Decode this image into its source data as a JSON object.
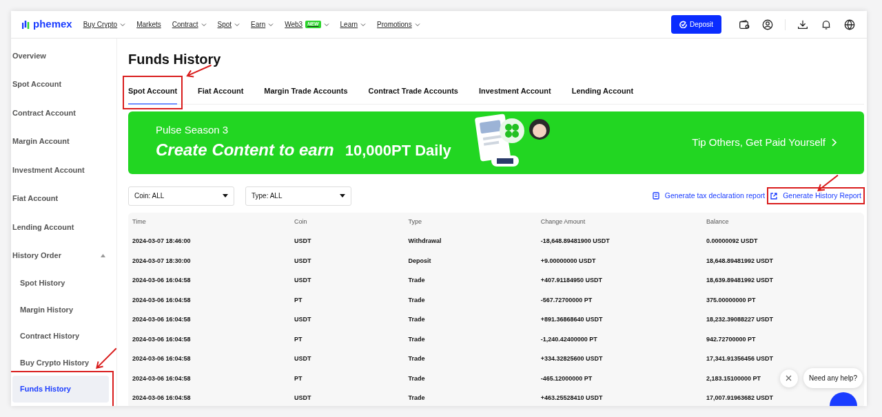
{
  "nav": {
    "logo": "phemex",
    "menu": [
      {
        "label": "Buy Crypto",
        "dropdown": true
      },
      {
        "label": "Markets",
        "dropdown": false
      },
      {
        "label": "Contract",
        "dropdown": true
      },
      {
        "label": "Spot",
        "dropdown": true
      },
      {
        "label": "Earn",
        "dropdown": true
      },
      {
        "label": "Web3",
        "dropdown": true,
        "badge": "NEW"
      },
      {
        "label": "Learn",
        "dropdown": true
      },
      {
        "label": "Promotions",
        "dropdown": true
      }
    ],
    "deposit": "Deposit"
  },
  "sidebar": {
    "items": [
      {
        "label": "Overview",
        "selected": false
      },
      {
        "label": "Spot Account",
        "selected": false
      },
      {
        "label": "Contract Account",
        "selected": false
      },
      {
        "label": "Margin Account",
        "selected": false
      },
      {
        "label": "Investment Account",
        "selected": false
      },
      {
        "label": "Fiat Account",
        "selected": false
      },
      {
        "label": "Lending Account",
        "selected": false
      },
      {
        "label": "History Order",
        "selected": false,
        "expanded": true,
        "children": [
          {
            "label": "Spot History",
            "selected": false,
            "annotated": false
          },
          {
            "label": "Margin History",
            "selected": false,
            "annotated": false
          },
          {
            "label": "Contract History",
            "selected": false,
            "annotated": false
          },
          {
            "label": "Buy Crypto History",
            "selected": false,
            "annotated": false
          },
          {
            "label": "Funds History",
            "selected": true,
            "annotated": true
          }
        ]
      }
    ]
  },
  "page_title": "Funds History",
  "tabs": [
    {
      "label": "Spot Account",
      "selected": true,
      "annotated": true
    },
    {
      "label": "Fiat Account",
      "selected": false,
      "annotated": false
    },
    {
      "label": "Margin Trade Accounts",
      "selected": false,
      "annotated": false
    },
    {
      "label": "Contract Trade Accounts",
      "selected": false,
      "annotated": false
    },
    {
      "label": "Investment Account",
      "selected": false,
      "annotated": false
    },
    {
      "label": "Lending Account",
      "selected": false,
      "annotated": false
    }
  ],
  "banner": {
    "kicker": "Pulse Season 3",
    "headline": "Create Content to earn",
    "amount": "10,000PT Daily",
    "cta": "Tip Others, Get Paid Yourself"
  },
  "filters": [
    {
      "value": "Coin: ALL"
    },
    {
      "value": "Type: ALL"
    }
  ],
  "links": [
    {
      "label": "Generate tax declaration report",
      "annotated": false
    },
    {
      "label": "Generate History Report",
      "annotated": true
    }
  ],
  "table": {
    "columns": [
      "Time",
      "Coin",
      "Type",
      "Change Amount",
      "Balance"
    ],
    "rows": [
      [
        "2024-03-07 18:46:00",
        "USDT",
        "Withdrawal",
        "-18,648.89481900 USDT",
        "0.00000092 USDT"
      ],
      [
        "2024-03-07 18:30:00",
        "USDT",
        "Deposit",
        "+9.00000000 USDT",
        "18,648.89481992 USDT"
      ],
      [
        "2024-03-06 16:04:58",
        "USDT",
        "Trade",
        "+407.91184950 USDT",
        "18,639.89481992 USDT"
      ],
      [
        "2024-03-06 16:04:58",
        "PT",
        "Trade",
        "-567.72700000 PT",
        "375.00000000 PT"
      ],
      [
        "2024-03-06 16:04:58",
        "USDT",
        "Trade",
        "+891.36868640 USDT",
        "18,232.39088227 USDT"
      ],
      [
        "2024-03-06 16:04:58",
        "PT",
        "Trade",
        "-1,240.42400000 PT",
        "942.72700000 PT"
      ],
      [
        "2024-03-06 16:04:58",
        "USDT",
        "Trade",
        "+334.32825600 USDT",
        "17,341.91356456 USDT"
      ],
      [
        "2024-03-06 16:04:58",
        "PT",
        "Trade",
        "-465.12000000 PT",
        "2,183.15100000 PT"
      ],
      [
        "2024-03-06 16:04:58",
        "USDT",
        "Trade",
        "+463.25528410 USDT",
        "17,007.91963682 USDT"
      ]
    ]
  },
  "chat": {
    "message": "Need any help?"
  }
}
